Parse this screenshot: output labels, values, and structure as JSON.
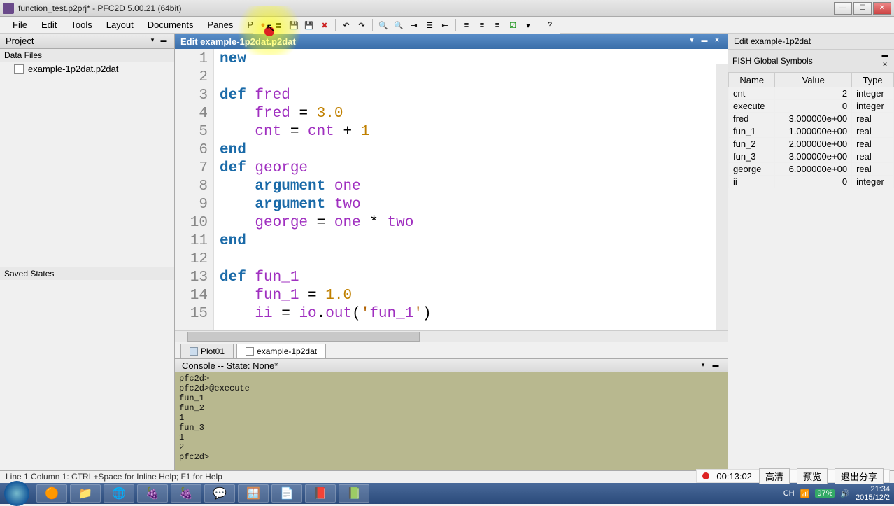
{
  "window": {
    "title": "function_test.p2prj* - PFC2D 5.00.21 (64bit)"
  },
  "menu": [
    "File",
    "Edit",
    "Tools",
    "Layout",
    "Documents",
    "Panes",
    "Python"
  ],
  "project_panel": {
    "title": "Project",
    "data_files_label": "Data Files",
    "files": [
      "example-1p2dat.p2dat"
    ],
    "saved_states_label": "Saved States"
  },
  "editor": {
    "tab_title": "Edit example-1p2dat.p2dat",
    "lines": [
      "new",
      "",
      "def fred",
      "    fred = 3.0",
      "    cnt = cnt + 1",
      "end",
      "def george",
      "    argument one",
      "    argument two",
      "    george = one * two",
      "end",
      "",
      "def fun_1",
      "    fun_1 = 1.0",
      "    ii = io.out('fun_1')"
    ]
  },
  "doc_tabs": {
    "plot": "Plot01",
    "file": "example-1p2dat"
  },
  "console": {
    "title": "Console -- State: None*",
    "lines": [
      "pfc2d>",
      "pfc2d>@execute",
      "fun_1",
      "fun_2",
      "1",
      "fun_3",
      "1",
      "2",
      "pfc2d>"
    ]
  },
  "right_panel": {
    "edit_label": "Edit example-1p2dat",
    "fish_label": "FISH Global Symbols",
    "columns": [
      "Name",
      "Value",
      "Type"
    ],
    "rows": [
      {
        "name": "cnt",
        "value": "2",
        "type": "integer"
      },
      {
        "name": "execute",
        "value": "0",
        "type": "integer"
      },
      {
        "name": "fred",
        "value": "3.000000e+00",
        "type": "real"
      },
      {
        "name": "fun_1",
        "value": "1.000000e+00",
        "type": "real"
      },
      {
        "name": "fun_2",
        "value": "2.000000e+00",
        "type": "real"
      },
      {
        "name": "fun_3",
        "value": "3.000000e+00",
        "type": "real"
      },
      {
        "name": "george",
        "value": "6.000000e+00",
        "type": "real"
      },
      {
        "name": "ii",
        "value": "0",
        "type": "integer"
      }
    ]
  },
  "status": "Line 1 Column 1: CTRL+Space for Inline Help; F1 for Help",
  "recording": {
    "time": "00:13:02",
    "btn_hq": "高清",
    "btn_preview": "预览",
    "btn_exit": "退出分享",
    "top_label": ""
  },
  "tray": {
    "ime": "CH",
    "battery": "97%",
    "time": "21:34",
    "date": "2015/12/2"
  }
}
